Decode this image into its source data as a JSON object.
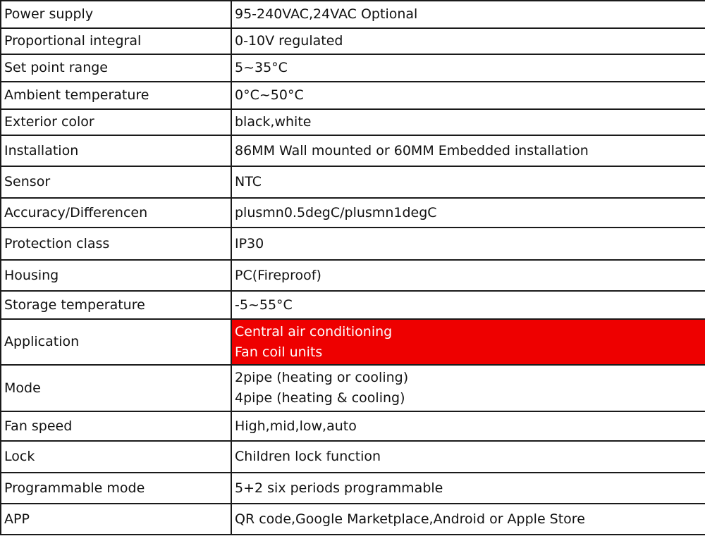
{
  "colors": {
    "highlight_background": "#ee0000",
    "highlight_text": "#ffffff",
    "border": "#1a1a1a"
  },
  "rows": [
    {
      "label": "Power supply",
      "value": "95-240VAC,24VAC Optional"
    },
    {
      "label": "Proportional integral",
      "value": "0-10V regulated"
    },
    {
      "label": "Set point range",
      "value": "5~35°C"
    },
    {
      "label": "Ambient temperature",
      "value": "0°C~50°C"
    },
    {
      "label": "Exterior color",
      "value": "black,white"
    },
    {
      "label": "Installation",
      "value": "86MM Wall mounted or 60MM Embedded installation"
    },
    {
      "label": "Sensor",
      "value": "NTC"
    },
    {
      "label": "Accuracy/Differencen",
      "value": "plusmn0.5degC/plusmn1degC"
    },
    {
      "label": "Protection class",
      "value": "IP30"
    },
    {
      "label": "Housing",
      "value": "PC(Fireproof)"
    },
    {
      "label": "Storage temperature",
      "value": "-5~55°C"
    },
    {
      "label": "Application",
      "value_lines": [
        "Central air conditioning",
        "Fan coil units"
      ]
    },
    {
      "label": "Mode",
      "value_lines": [
        "2pipe (heating or cooling)",
        "4pipe (heating & cooling)"
      ]
    },
    {
      "label": "Fan speed",
      "value": "High,mid,low,auto"
    },
    {
      "label": "Lock",
      "value": "Children  lock function"
    },
    {
      "label": "Programmable mode",
      "value": "5+2 six periods programmable"
    },
    {
      "label": "APP",
      "value": "QR  code,Google Marketplace,Android or Apple Store"
    }
  ]
}
